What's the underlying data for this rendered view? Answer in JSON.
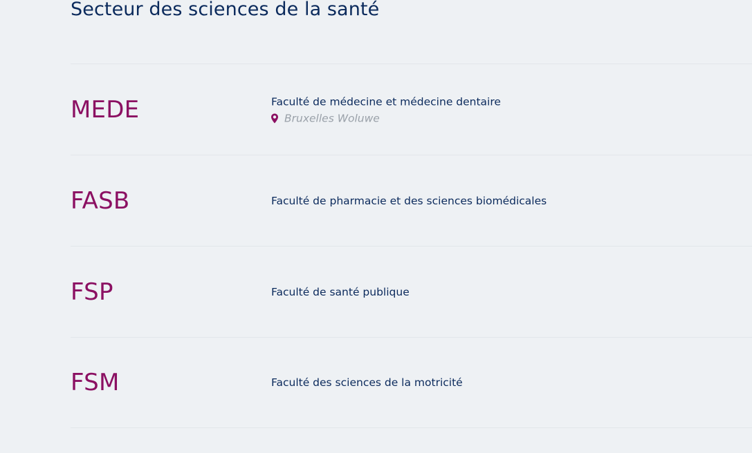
{
  "section": {
    "title": "Secteur des sciences de la santé"
  },
  "faculties": [
    {
      "code": "MEDE",
      "name": "Faculté de médecine et médecine dentaire",
      "location": "Bruxelles Woluwe",
      "location_icon": "map-pin-icon"
    },
    {
      "code": "FASB",
      "name": "Faculté de pharmacie et des sciences biomédicales"
    },
    {
      "code": "FSP",
      "name": "Faculté de santé publique"
    },
    {
      "code": "FSM",
      "name": "Faculté des sciences de la motricité"
    }
  ],
  "colors": {
    "background": "#eef1f4",
    "title": "#0b2a5c",
    "code": "#8b1062",
    "location": "#9aa1a9",
    "divider": "#e2e6ea"
  }
}
